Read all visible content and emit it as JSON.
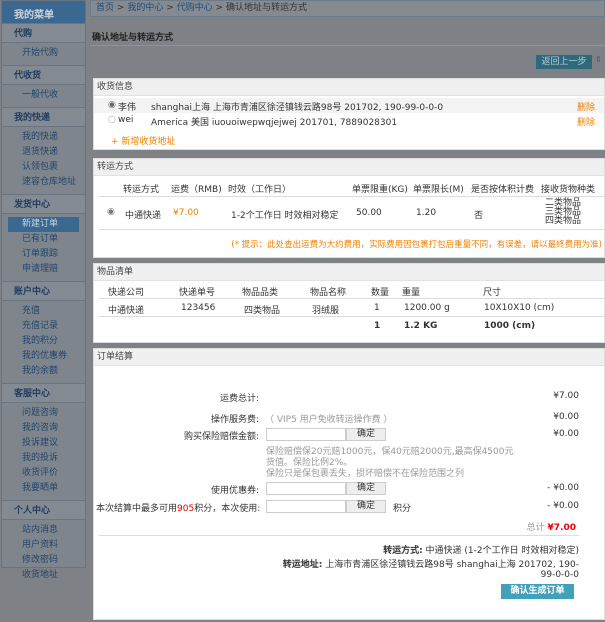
{
  "sidebar": {
    "title": "我的菜单",
    "groups": [
      {
        "label": "代购",
        "items": [
          "开始代购"
        ]
      },
      {
        "label": "代收货",
        "items": [
          "一般代收"
        ]
      },
      {
        "label": "我的快递",
        "items": [
          "我的快递",
          "退货快递",
          "认领包裹",
          "速容仓库地址"
        ]
      },
      {
        "label": "发货中心",
        "items": [
          "新建订单",
          "已有订单",
          "订单跟踪",
          "申请理赔"
        ]
      },
      {
        "label": "账户中心",
        "items": [
          "充值",
          "充值记录",
          "我的积分",
          "我的优惠券",
          "我的余额"
        ]
      },
      {
        "label": "客服中心",
        "items": [
          "问题咨询",
          "我的咨询",
          "投诉建议",
          "我的投诉",
          "收货评价",
          "我要晒单"
        ]
      },
      {
        "label": "个人中心",
        "items": [
          "站内消息",
          "用户资料",
          "修改密码",
          "收货地址"
        ]
      }
    ],
    "active": "新建订单"
  },
  "breadcrumb": {
    "home": "首页",
    "sep": ">",
    "center": "我的中心",
    "daigou": "代购中心",
    "current": "确认地址与转运方式"
  },
  "page_title": "确认地址与转运方式",
  "back_button": "返回上一步",
  "address": {
    "header": "收货信息",
    "rows": [
      {
        "name": "李伟",
        "address": "shanghai上海 上海市青浦区徐泾镇钱云路98号 201702, 190-99-0-0-0",
        "delete": "删除",
        "selected": true
      },
      {
        "name": "wei",
        "address": "America 美国 iuouoiwepwqjejwej 201701, 7889028301",
        "delete": "删除",
        "selected": false
      }
    ],
    "add": "+ 新增收货地址"
  },
  "shipping": {
    "header": "转运方式",
    "columns": [
      "转运方式",
      "运费（RMB)",
      "时效（工作日）",
      "单票限重(KG)",
      "单票限长(M)",
      "是否按体积计费",
      "接收货物种类"
    ],
    "row": {
      "method": "中通快递",
      "fee": "¥7.00",
      "time": "1-2个工作日 时效相对稳定",
      "max_weight": "50.00",
      "max_length": "1.20",
      "volume": "否",
      "types": [
        "二类物品",
        "三类物品",
        "四类物品"
      ]
    },
    "tip": "(* 提示：此处查出运费为大约费用，实际费用因包裹打包后重量不同，有误差，请以最终费用为准)"
  },
  "items": {
    "header": "物品清单",
    "columns": [
      "快递公司",
      "快递单号",
      "物品品类",
      "物品名称",
      "数量",
      "重量",
      "尺寸"
    ],
    "row": [
      "中通快递",
      "123456",
      "四类物品",
      "羽绒服",
      "1",
      "1200.00 g",
      "10X10X10 (cm)"
    ],
    "total": {
      "qty": "1",
      "weight": "1.2 KG",
      "size": "1000 (cm)"
    }
  },
  "settlement": {
    "header": "订单结算",
    "freight_label": "运费总计:",
    "freight": "¥7.00",
    "service_label": "操作服务费:",
    "service_note": "（ VIP5 用户免收转运操作费 ）",
    "service": "¥0.00",
    "insurance_label": "购买保险赔偿金额:",
    "insurance": "¥0.00",
    "confirm": "确定",
    "insurance_note1": "保险赔偿保20元赔1000元，保40元赔2000元,最高保4500元",
    "insurance_note2": "货值。保险比例2%。",
    "insurance_note3": "保险只是保包裹丢失，损坏赔偿不在保险范围之列",
    "coupon_label": "使用优惠券:",
    "coupon": "- ¥0.00",
    "points_prefix": "本次结算中最多可用",
    "points_max": "905",
    "points_suffix": "积分，本次使用:",
    "points_unit": "积分",
    "points": "- ¥0.00",
    "total_label": "总计",
    "total": "¥7.00",
    "method_label": "转运方式:",
    "method": "中通快递 (1-2个工作日 时效相对稳定)",
    "addr_label": "转运地址:",
    "addr1": "上海市青浦区徐泾镇钱云路98号 shanghai上海 201702, 190-",
    "addr2": "99-0-0-0",
    "submit": "确认生成订单"
  }
}
